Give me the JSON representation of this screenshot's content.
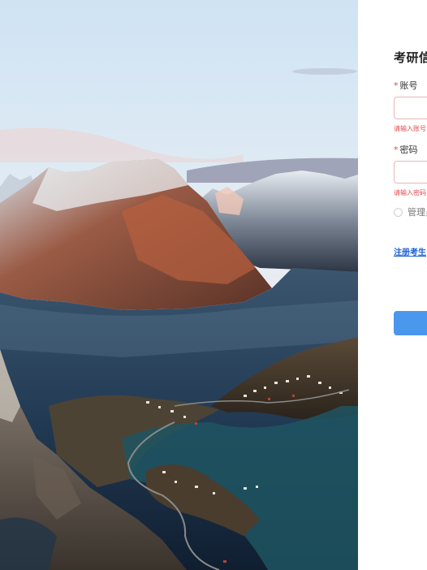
{
  "hero": {
    "image": "lofoten-mountain-fjord-landscape"
  },
  "login": {
    "title": "考研信",
    "account_label": "账号",
    "account_required": "*",
    "account_error": "请输入账号",
    "password_label": "密码",
    "password_required": "*",
    "password_error": "请输入密码",
    "admin_option": "管理员",
    "register_link": "注册考生",
    "submit_label": ""
  },
  "colors": {
    "accent": "#4a97ee",
    "error": "#e5484d",
    "link": "#1a5fd6"
  }
}
